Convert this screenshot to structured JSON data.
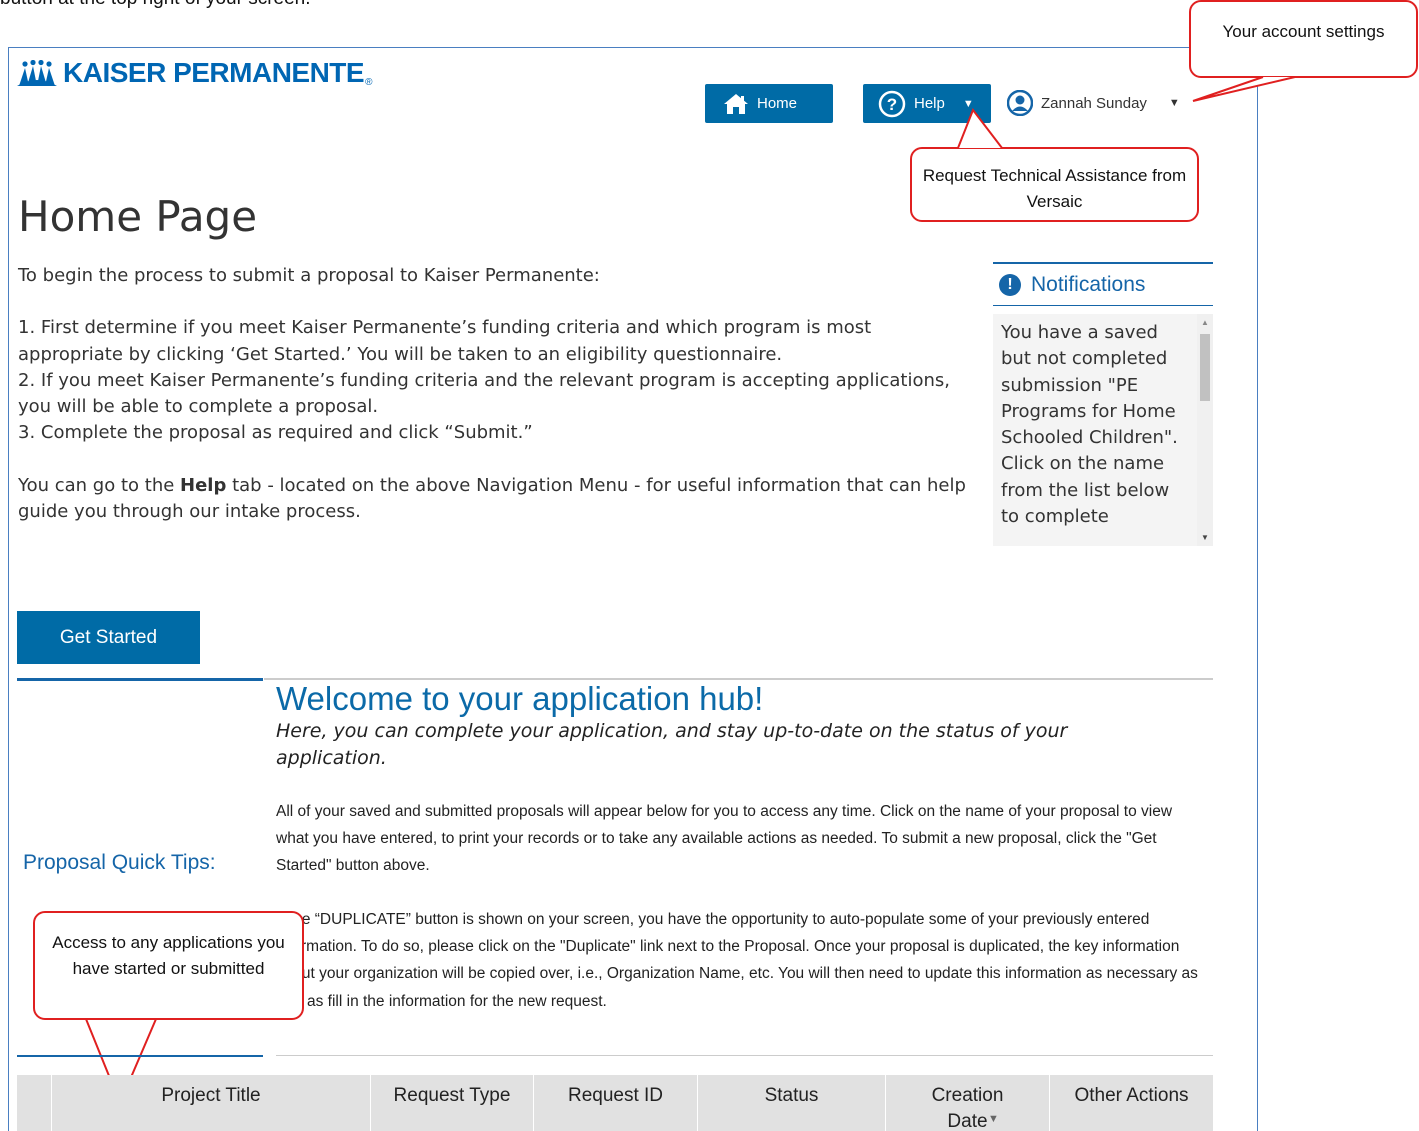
{
  "header": {
    "top_text": "button at the top right of your screen.",
    "logo_text": "KAISER PERMANENTE",
    "logo_reg": "®",
    "nav": {
      "home_label": "Home",
      "help_label": "Help",
      "user_name": "Zannah Sunday"
    }
  },
  "callouts": {
    "account": "Your account settings",
    "help": "Request Technical Assistance from Versaic",
    "access": "Access to any applications you have started or submitted"
  },
  "main": {
    "title": "Home Page",
    "intro_line": "To begin the process to submit a proposal to Kaiser Permanente:",
    "steps": [
      "1. First determine if you meet Kaiser Permanente’s funding criteria and which program is most appropriate by clicking ‘Get Started.’ You will be taken to an eligibility questionnaire.",
      "2. If you meet Kaiser Permanente’s funding criteria and the relevant program is accepting applications, you will be able to complete a proposal.",
      "3. Complete the proposal as required and click “Submit.”"
    ],
    "help_pre": "You can go to the ",
    "help_bold": "Help",
    "help_post": " tab - located on the above Navigation Menu -  for useful information that can help guide you through our intake process.",
    "get_started": "Get Started"
  },
  "notifications": {
    "title": "Notifications",
    "message": "You have a saved but not completed submission \"PE Programs for Home Schooled Children\". Click on the name from the list below to complete"
  },
  "hub": {
    "title": "Welcome to your application hub!",
    "subtitle": "Here, you can complete your application, and stay up-to-date on the status of your application.",
    "tips_title": "Proposal Quick Tips:",
    "para1": "All of your saved and submitted proposals will appear below for you to access any time. Click on the name of your proposal to view what you have entered, to print your records or to take any available actions as needed. To submit a new proposal, click the \"Get Started\" button above.",
    "para2": "If the “DUPLICATE” button is shown on your screen, you have the opportunity to auto-populate some of your previously entered information. To do so, please click on the \"Duplicate\" link next to the Proposal. Once your proposal is duplicated, the key information about your organization will be copied over, i.e., Organization Name, etc. You will then need to update this information as necessary as well as fill in the information for the new request."
  },
  "table": {
    "columns": [
      "",
      "Project Title",
      "Request Type",
      "Request ID",
      "Status",
      "Creation Date",
      "Other Actions"
    ]
  },
  "colors": {
    "primary": "#006ba6",
    "link_blue": "#1565a8",
    "callout_red": "#e02020"
  }
}
